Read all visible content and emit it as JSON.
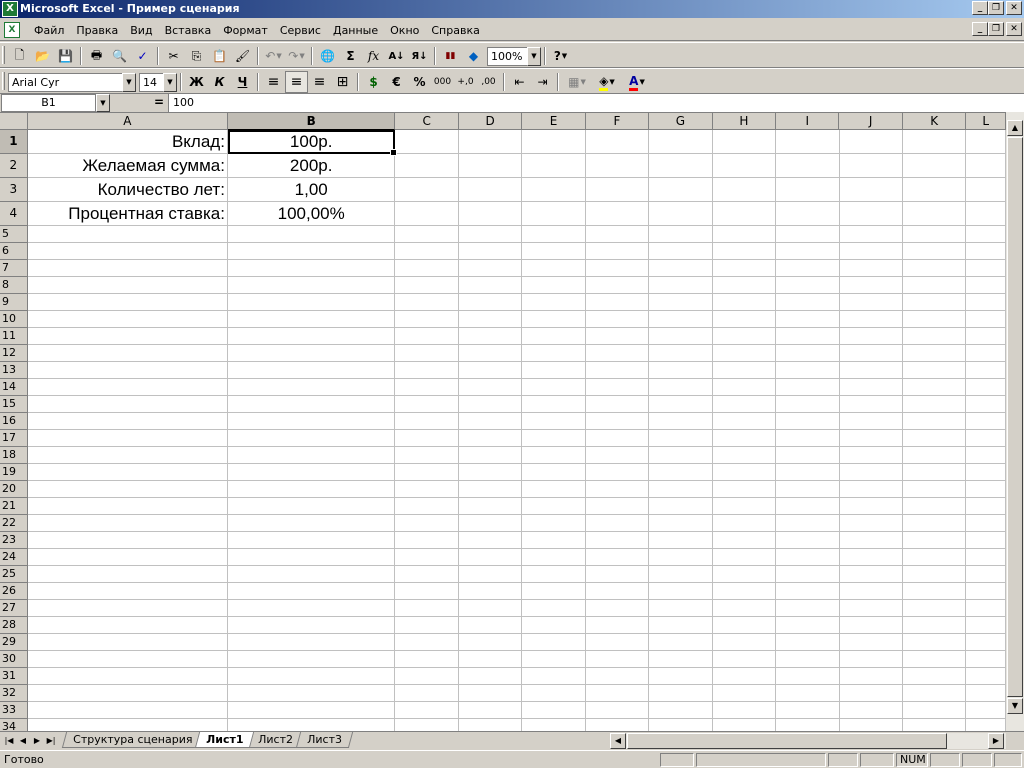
{
  "window": {
    "title": "Microsoft Excel - Пример сценария",
    "app_icon_letter": "X",
    "min_glyph": "_",
    "restore_glyph": "❐",
    "close_glyph": "✕"
  },
  "menu": {
    "items": [
      "Файл",
      "Правка",
      "Вид",
      "Вставка",
      "Формат",
      "Сервис",
      "Данные",
      "Окно",
      "Справка"
    ]
  },
  "toolbar_standard": {
    "zoom": "100%",
    "icons": [
      "new-icon",
      "open-icon",
      "save-icon",
      "print-icon",
      "print-preview-icon",
      "spelling-icon",
      "cut-icon",
      "copy-icon",
      "paste-icon",
      "format-painter-icon",
      "undo-icon",
      "redo-icon",
      "hyperlink-icon",
      "autosum-icon",
      "function-icon",
      "sort-ascending-icon",
      "sort-descending-icon",
      "chart-wizard-icon",
      "drawing-icon",
      "help-icon"
    ],
    "glyphs": {
      "new": "🗋",
      "open": "📂",
      "save": "💾",
      "print": "🖶",
      "preview": "🔍",
      "spelling": "✓",
      "cut": "✂",
      "copy": "⎘",
      "paste": "📋",
      "painter": "🖌",
      "undo": "↶",
      "redo": "↷",
      "hyperlink": "🌐",
      "autosum": "Σ",
      "function": "fx",
      "sort_asc": "A↓",
      "sort_desc": "Я↓",
      "chart": "▮▮",
      "drawing": "◆",
      "help": "?"
    }
  },
  "toolbar_formatting": {
    "font": "Arial Cyr",
    "size": "14",
    "bold": "Ж",
    "italic": "К",
    "underline": "Ч",
    "euro": "€",
    "percent": "%",
    "thousands": "000",
    "inc_decimal": "+,0",
    "dec_decimal": ",00",
    "font_color": "#ff0000",
    "fill_color": "#ffff00",
    "glyphs": {
      "align_left": "≡",
      "align_center": "≡",
      "align_right": "≡",
      "merge": "⊞",
      "currency": "$",
      "indent_dec": "⇤",
      "indent_inc": "⇥",
      "borders": "▦",
      "fill": "◈",
      "fontcolor": "A"
    }
  },
  "formula_bar": {
    "name_box": "B1",
    "equals": "=",
    "content": "100"
  },
  "grid": {
    "columns": [
      "A",
      "B",
      "C",
      "D",
      "E",
      "F",
      "G",
      "H",
      "I",
      "J",
      "K",
      "L"
    ],
    "selected_column": "B",
    "selected_row": 1,
    "cells": {
      "A1": "Вклад:",
      "B1": "100р.",
      "A2": "Желаемая сумма:",
      "B2": "200р.",
      "A3": "Количество лет:",
      "B3": "1,00",
      "A4": "Процентная ставка:",
      "B4": "100,00%"
    },
    "row_count": 34
  },
  "sheets": {
    "tabs": [
      "Структура сценария",
      "Лист1",
      "Лист2",
      "Лист3"
    ],
    "active": "Лист1"
  },
  "status": {
    "text": "Готово",
    "num": "NUM"
  }
}
